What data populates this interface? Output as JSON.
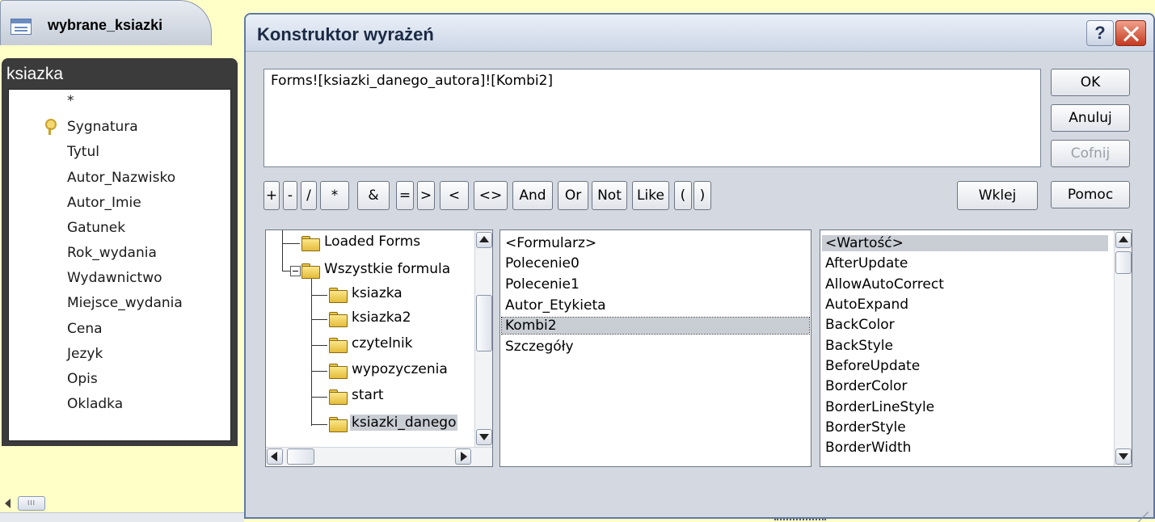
{
  "background": {
    "tab_label": "wybrane_ksiazki",
    "table": {
      "title": "ksiazka",
      "fields": [
        "*",
        "Sygnatura",
        "Tytul",
        "Autor_Nazwisko",
        "Autor_Imie",
        "Gatunek",
        "Rok_wydania",
        "Wydawnictwo",
        "Miejsce_wydania",
        "Cena",
        "Jezyk",
        "Opis",
        "Okladka"
      ],
      "primary_key": "Sygnatura"
    }
  },
  "dialog": {
    "title": "Konstruktor wyrażeń",
    "help_label": "?",
    "expression": "Forms![ksiazki_danego_autora]![Kombi2]",
    "buttons": {
      "ok": "OK",
      "cancel": "Anuluj",
      "undo": "Cofnij",
      "paste": "Wklej",
      "help": "Pomoc"
    },
    "operators": [
      "+",
      "-",
      "/",
      "*",
      "&",
      "=",
      ">",
      "<",
      "<>",
      "And",
      "Or",
      "Not",
      "Like",
      "(",
      ")"
    ],
    "tree": {
      "items": [
        {
          "label": "Loaded Forms",
          "level": 0
        },
        {
          "label": "Wszystkie formula",
          "level": 0,
          "expanded": true
        },
        {
          "label": "ksiazka",
          "level": 1
        },
        {
          "label": "ksiazka2",
          "level": 1
        },
        {
          "label": "czytelnik",
          "level": 1
        },
        {
          "label": "wypozyczenia",
          "level": 1
        },
        {
          "label": "start",
          "level": 1
        },
        {
          "label": "ksiazki_danego",
          "level": 1,
          "selected": true,
          "open": true
        }
      ]
    },
    "controls": {
      "items": [
        "<Formularz>",
        "Polecenie0",
        "Polecenie1",
        "Autor_Etykieta",
        "Kombi2",
        "Szczegóły"
      ],
      "focused": "Kombi2"
    },
    "properties": {
      "items": [
        "<Wartość>",
        "AfterUpdate",
        "AllowAutoCorrect",
        "AutoExpand",
        "BackColor",
        "BackStyle",
        "BeforeUpdate",
        "BorderColor",
        "BorderLineStyle",
        "BorderStyle",
        "BorderWidth"
      ],
      "selected": "<Wartość>"
    }
  },
  "colors": {
    "background": "#ffffc8",
    "dialog": "#d4d8e0",
    "selection": "#c9cdd4",
    "close": "#c5391f"
  }
}
